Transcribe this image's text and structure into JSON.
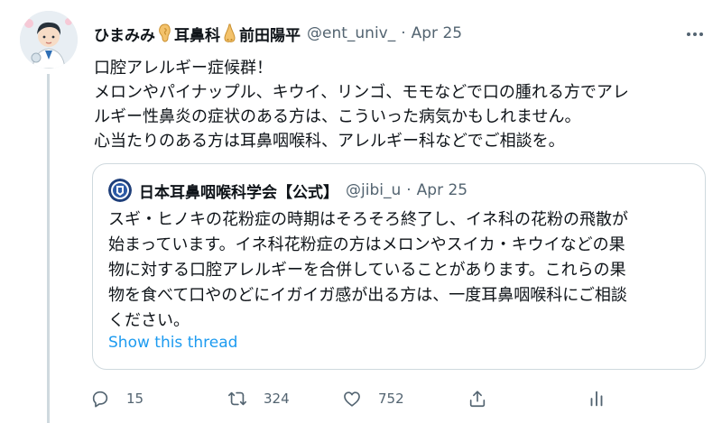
{
  "tweet": {
    "author": {
      "name_part1": "ひまみみ",
      "name_part2": "耳鼻科",
      "name_part3": "前田陽平",
      "handle": "@ent_univ_",
      "date": "Apr 25"
    },
    "separator": "·",
    "body_lines": [
      "口腔アレルギー症候群！",
      "メロンやパイナップル、キウイ、リンゴ、モモなどで口の腫れる方でアレ",
      "ルギー性鼻炎の症状のある方は、こういった病気かもしれません。",
      "心当たりのある方は耳鼻咽喉科、アレルギー科などでご相談を。"
    ],
    "quote": {
      "name": "日本耳鼻咽喉科学会【公式】",
      "handle": "@jibi_u",
      "date": "Apr 25",
      "body_lines": [
        "スギ・ヒノキの花粉症の時期はそろそろ終了し、イネ科の花粉の飛散が",
        "始まっています。イネ科花粉症の方はメロンやスイカ・キウイなどの果",
        "物に対する口腔アレルギーを合併していることがあります。これらの果",
        "物を食べて口やのどにイガイガ感が出る方は、一度耳鼻咽喉科にご相談",
        "ください。"
      ],
      "show_thread": "Show this thread"
    },
    "actions": {
      "reply_count": "15",
      "retweet_count": "324",
      "like_count": "752"
    },
    "icons": {
      "more": "more-horizontal-icon",
      "reply": "reply-icon",
      "retweet": "retweet-icon",
      "like": "heart-icon",
      "share": "share-icon",
      "analytics": "analytics-icon"
    },
    "colors": {
      "text": "#0f1419",
      "secondary": "#536471",
      "link": "#1d9bf0",
      "border": "#cfd9de"
    }
  }
}
